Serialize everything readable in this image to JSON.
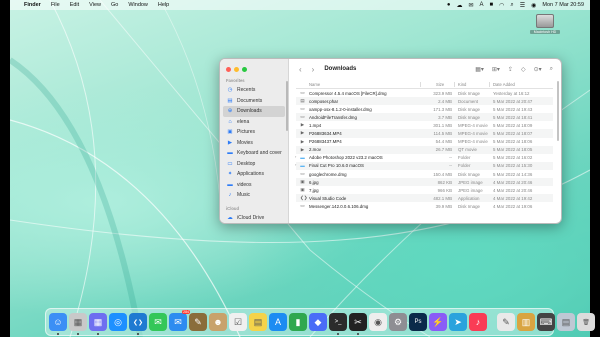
{
  "menubar": {
    "app_name": "Finder",
    "menus": [
      "File",
      "Edit",
      "View",
      "Go",
      "Window",
      "Help"
    ],
    "clock": "Mon 7 Mar  20:59"
  },
  "desktop_disk": {
    "label": "Macintosh HD"
  },
  "finder": {
    "title": "Downloads",
    "sidebar": {
      "favorites_header": "Favorites",
      "items": [
        {
          "label": "Recents",
          "icon": "clock-icon"
        },
        {
          "label": "Documents",
          "icon": "document-icon"
        },
        {
          "label": "Downloads",
          "icon": "download-icon",
          "active": true
        },
        {
          "label": "elena",
          "icon": "home-icon"
        },
        {
          "label": "Pictures",
          "icon": "pictures-icon"
        },
        {
          "label": "Movies",
          "icon": "movies-icon"
        },
        {
          "label": "Keyboard and cover",
          "icon": "folder-icon"
        },
        {
          "label": "Desktop",
          "icon": "desktop-icon"
        },
        {
          "label": "Applications",
          "icon": "applications-icon"
        },
        {
          "label": "videos",
          "icon": "folder-icon"
        },
        {
          "label": "Music",
          "icon": "music-icon"
        }
      ],
      "icloud_header": "iCloud",
      "icloud_items": [
        {
          "label": "iCloud Drive",
          "icon": "cloud-icon"
        }
      ]
    },
    "columns": {
      "name": "Name",
      "size": "Size",
      "kind": "Kind",
      "date": "Date Added"
    },
    "files": [
      {
        "name": "Compressor 4.5.4 macOS [FileCR].dmg",
        "size": "323.9 MB",
        "kind": "Disk Image",
        "date": "Yesterday at 16:12",
        "icon": "dmg-icon"
      },
      {
        "name": "composer.phar",
        "size": "2.4 MB",
        "kind": "Document",
        "date": "5 Mar 2022 at 20:47",
        "icon": "document-icon"
      },
      {
        "name": "xampp-osx-8.1.2-0-installer.dmg",
        "size": "171.3 MB",
        "kind": "Disk Image",
        "date": "5 Mar 2022 at 19:43",
        "icon": "dmg-icon"
      },
      {
        "name": "AndroidFileTransfer.dmg",
        "size": "3.7 MB",
        "kind": "Disk Image",
        "date": "5 Mar 2022 at 18:41",
        "icon": "dmg-icon"
      },
      {
        "name": "1.mp4",
        "size": "301.1 MB",
        "kind": "MPEG-4 movie",
        "date": "5 Mar 2022 at 18:09",
        "icon": "video-icon"
      },
      {
        "name": "P26883634.MP4",
        "size": "114.5 MB",
        "kind": "MPEG-4 movie",
        "date": "5 Mar 2022 at 18:07",
        "icon": "video-icon"
      },
      {
        "name": "P26883437.MP4",
        "size": "54.4 MB",
        "kind": "MPEG-4 movie",
        "date": "5 Mar 2022 at 18:06",
        "icon": "video-icon"
      },
      {
        "name": "2.mov",
        "size": "26.7 MB",
        "kind": "QT movie",
        "date": "5 Mar 2022 at 18:05",
        "icon": "video-icon"
      },
      {
        "name": "Adobe Photoshop 2022 v23.2 macOS",
        "size": "--",
        "kind": "Folder",
        "date": "5 Mar 2022 at 16:02",
        "icon": "folder-icon",
        "folder": true
      },
      {
        "name": "Final Cut Pro 10.6.0 macOS",
        "size": "--",
        "kind": "Folder",
        "date": "5 Mar 2022 at 15:30",
        "icon": "folder-icon",
        "folder": true
      },
      {
        "name": "googlechrome.dmg",
        "size": "150.4 MB",
        "kind": "Disk Image",
        "date": "5 Mar 2022 at 14:36",
        "icon": "dmg-icon"
      },
      {
        "name": "6.jpg",
        "size": "862 KB",
        "kind": "JPEG image",
        "date": "4 Mar 2022 at 20:46",
        "icon": "image-icon"
      },
      {
        "name": "7.jpg",
        "size": "966 KB",
        "kind": "JPEG image",
        "date": "4 Mar 2022 at 20:46",
        "icon": "image-icon"
      },
      {
        "name": "Visual Studio Code",
        "size": "482.1 MB",
        "kind": "Application",
        "date": "4 Mar 2022 at 19:42",
        "icon": "vscode-icon"
      },
      {
        "name": "Messenger.142.0.0.6.106.dmg",
        "size": "39.9 MB",
        "kind": "Disk Image",
        "date": "4 Mar 2022 at 19:06",
        "icon": "dmg-icon"
      }
    ]
  },
  "dock": {
    "apps": [
      {
        "name": "Finder",
        "icon": "finder-icon",
        "color": "#3b8ff5"
      },
      {
        "name": "Launchpad",
        "icon": "launchpad-icon",
        "color": "#c9c9c9"
      },
      {
        "name": "App Grid",
        "icon": "grid-icon",
        "color": "#6e6ef0"
      },
      {
        "name": "Safari",
        "icon": "safari-icon",
        "color": "#1e90ff"
      },
      {
        "name": "Visual Studio Code",
        "icon": "vscode-icon",
        "color": "#1f7ad1"
      },
      {
        "name": "Messages",
        "icon": "messages-icon",
        "color": "#34c759"
      },
      {
        "name": "Mail",
        "icon": "mail-icon",
        "color": "#2d8cf0",
        "badge": "284"
      },
      {
        "name": "Notes",
        "icon": "notes-icon",
        "color": "#8a6d3b"
      },
      {
        "name": "Contacts",
        "icon": "contacts-icon",
        "color": "#c8a26b"
      },
      {
        "name": "Reminders",
        "icon": "reminders-icon",
        "color": "#f0f0f0"
      },
      {
        "name": "Stickies",
        "icon": "stickies-icon",
        "color": "#f5d34a"
      },
      {
        "name": "App Store",
        "icon": "appstore-icon",
        "color": "#1c8cf2"
      },
      {
        "name": "Numbers",
        "icon": "numbers-icon",
        "color": "#2fa84f"
      },
      {
        "name": "Keynote",
        "icon": "keynote-icon",
        "color": "#4a6cf7"
      },
      {
        "name": "Terminal",
        "icon": "terminal-icon",
        "color": "#2b2b2b"
      },
      {
        "name": "Final Cut Pro",
        "icon": "finalcut-icon",
        "color": "#222222"
      },
      {
        "name": "Chrome",
        "icon": "chrome-icon",
        "color": "#eeeeee"
      },
      {
        "name": "Settings",
        "icon": "gear-icon",
        "color": "#8e8e93"
      },
      {
        "name": "Photoshop",
        "icon": "photoshop-icon",
        "color": "#0b2a4a"
      },
      {
        "name": "Messenger",
        "icon": "messenger-icon",
        "color": "#8a5cf6"
      },
      {
        "name": "Telegram",
        "icon": "telegram-icon",
        "color": "#2aa3dd"
      },
      {
        "name": "Music",
        "icon": "music-icon",
        "color": "#fa3c55"
      },
      {
        "name": "TextEdit",
        "icon": "textedit-icon",
        "color": "#e9e9e9"
      },
      {
        "name": "Archive Utility",
        "icon": "archive-icon",
        "color": "#d9a441"
      },
      {
        "name": "Keyboard Viewer",
        "icon": "keyboard-icon",
        "color": "#444444"
      },
      {
        "name": "Downloads Stack",
        "icon": "downloads-stack-icon",
        "color": "#bfc8d4"
      },
      {
        "name": "Trash",
        "icon": "trash-icon",
        "color": "#dcdcdc"
      }
    ]
  }
}
